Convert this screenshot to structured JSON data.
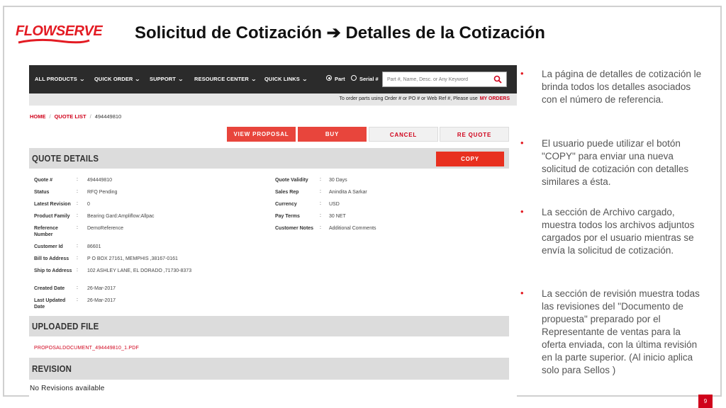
{
  "logo": {
    "text": "FLOWSERVE"
  },
  "slide": {
    "title": "Solicitud de Cotización ➔ Detalles de la Cotización",
    "page_number": "9"
  },
  "navbar": {
    "items": [
      "ALL PRODUCTS",
      "QUICK ORDER",
      "SUPPORT",
      "RESOURCE CENTER",
      "QUICK LINKS"
    ],
    "radio_part": "Part",
    "radio_serial": "Serial #",
    "search_placeholder": "Part #, Name, Desc. or Any Keyword"
  },
  "subbar": {
    "text": "To order parts using Order # or PO # or Web Ref #, Please use",
    "link": "MY ORDERS"
  },
  "breadcrumb": {
    "home": "HOME",
    "quote_list": "QUOTE LIST",
    "current": "494449810"
  },
  "actions": {
    "view_proposal": "VIEW PROPOSAL",
    "buy": "BUY",
    "cancel": "CANCEL",
    "re_quote": "RE QUOTE"
  },
  "quote_details": {
    "title": "QUOTE DETAILS",
    "copy": "COPY",
    "left": [
      {
        "label": "Quote #",
        "value": "494449810"
      },
      {
        "label": "Status",
        "value": "RFQ Pending"
      },
      {
        "label": "Latest Revision",
        "value": "0"
      },
      {
        "label": "Product Family",
        "value": "Bearing Gard:Ampliflow:Allpac"
      },
      {
        "label": "Reference Number",
        "value": "DemoReference"
      },
      {
        "label": "Customer Id",
        "value": "86601"
      },
      {
        "label": "Bill to Address",
        "value": "P O BOX 27161, MEMPHIS ,38167-0161"
      },
      {
        "label": "Ship to Address",
        "value": "102 ASHLEY LANE, EL DORADO ,71730-8373"
      },
      {
        "label": "Created Date",
        "value": "26-Mar-2017"
      },
      {
        "label": "Last Updated Date",
        "value": "26-Mar-2017"
      }
    ],
    "right": [
      {
        "label": "Quote Validity",
        "value": "30 Days"
      },
      {
        "label": "Sales Rep",
        "value": "Anindita A Sarkar"
      },
      {
        "label": "Currency",
        "value": "USD"
      },
      {
        "label": "Pay Terms",
        "value": "30 NET"
      },
      {
        "label": "Customer Notes",
        "value": "Additional Comments"
      }
    ]
  },
  "uploaded_file": {
    "title": "UPLOADED FILE",
    "file": "PROPOSALDOCUMENT_494449810_1.PDF"
  },
  "revision": {
    "title": "REVISION",
    "empty_text": "No Revisions available"
  },
  "bullets": [
    "La página de detalles de cotización le brinda todos los detalles asociados con el número de referencia.",
    "El usuario puede utilizar el botón \"COPY\" para enviar una nueva solicitud de cotización con detalles similares a ésta.",
    "La sección de Archivo cargado, muestra todos los archivos adjuntos cargados por el usuario mientras se envía la solicitud de cotización.",
    "La sección de revisión muestra todas las revisiones del \"Documento de propuesta\" preparado por el Representante de ventas para la oferta enviada, con la última revisión en la parte superior. (Al inicio aplica solo para Sellos )"
  ],
  "colors": {
    "brand_red": "#e31b23",
    "navbar": "#2b2b2b",
    "section_bar": "#dcdcdc"
  }
}
